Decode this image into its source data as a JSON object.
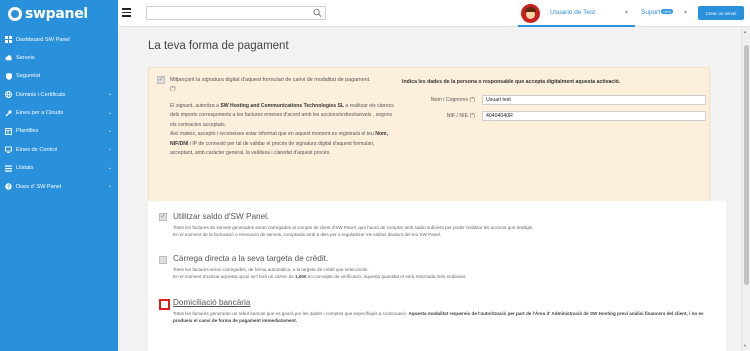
{
  "brand": {
    "name": "swpanel"
  },
  "sidebar": {
    "items": [
      {
        "label": "Dashboard SW Panel",
        "icon": "dashboard-icon",
        "has_caret": false
      },
      {
        "label": "Serveis",
        "icon": "cloud-icon",
        "has_caret": false
      },
      {
        "label": "Seguretat",
        "icon": "shield-icon",
        "has_caret": false
      },
      {
        "label": "Dominis i Certificats",
        "icon": "globe-icon",
        "has_caret": true
      },
      {
        "label": "Eines per a Clouds",
        "icon": "tools-icon",
        "has_caret": true
      },
      {
        "label": "Plantilles",
        "icon": "templates-icon",
        "has_caret": true
      },
      {
        "label": "Eines de Control",
        "icon": "control-icon",
        "has_caret": true
      },
      {
        "label": "Llistats",
        "icon": "list-icon",
        "has_caret": true
      },
      {
        "label": "Dues d' SW Panel",
        "icon": "question-icon",
        "has_caret": true
      }
    ]
  },
  "topbar": {
    "search_placeholder": "",
    "user_name": "Usuario de Test",
    "support_label": "Suport",
    "support_badge": "NEW",
    "create_button": "Crear un servei"
  },
  "page": {
    "title": "La teva forma de pagament"
  },
  "signature": {
    "checked": true,
    "checkbox_label": "Mitjançant la signatura digital d'aquest formulari de canvi de modalitat de pagament. (*)",
    "intro": "El signant, autoritza a ",
    "company": "SW Hosting and Communications Technologies SL",
    "intro_rest": " a realitzar els càrrecs dels imports corresponents a les factures emeses d'acord amb les accions/ordres/serveis , segons els contractes acceptats.",
    "registry_start": "Així mateix, accepto i reconeixes estar informat que en aquest moment es registrarà el teu ",
    "registry_bold": "Nom, NIF/DNI",
    "registry_rest": " i IP de connexió per tal de validar el procés de signatura digital d'aquest formulari, acceptant, amb caràcter general, la validesa i claredat d'aquest procés.",
    "form_title": "Indica les dades de la persona o responsable que accepta digitalment aquesta activació.",
    "name_label": "Nom i Cognoms (*)",
    "name_value": "Usuari test",
    "nif_label": "NIF / NIE (*)",
    "nif_value": "40404040R"
  },
  "payment_options": [
    {
      "title": "Utilitzar saldo d'SW Panel.",
      "checked": true,
      "active": false,
      "desc1": "Totes les factures de serveis generades seran carregades al compte de client d'SW Panel, que haurà de comptar amb saldo suficient per poder realitzar les accions que desitgis.",
      "desc2": "En el moment de la facturació o renovació de serveis, comptaràs amb 5 dies per a regularitzar els saldos deutors del teu SW Panel."
    },
    {
      "title": "Càrrega directa a la seva targeta de crèdit.",
      "checked": false,
      "active": false,
      "desc1": "Totes les factures seran carregades, de forma automàtica, a la targeta de crèdit que seleccionis.",
      "desc2_pre": "En el moment d'activar aquesta opció se't farà un càrrec de ",
      "desc2_bold": "1,00€",
      "desc2_post": " en concepte de verificació. Aquesta quantitat et serà retornada més endavant."
    },
    {
      "title": "Domiciliació bancària",
      "checked": false,
      "active": true,
      "desc_pre": "Totes les factures generaran un rebut bancari que es girarà per les dades i comptes que especifiquis a continuació. ",
      "desc_bold": "Aquesta modalitat requereix de l'autorització per part de l'Àrea d' Administració de SW Hosting previ anàlisi financera del client, i no es produeix el canvi de forma de pagament immediatament."
    }
  ],
  "colors": {
    "brand": "#2990dc",
    "panel_bg": "#fcf0dc",
    "highlight": "#e21c1c"
  }
}
